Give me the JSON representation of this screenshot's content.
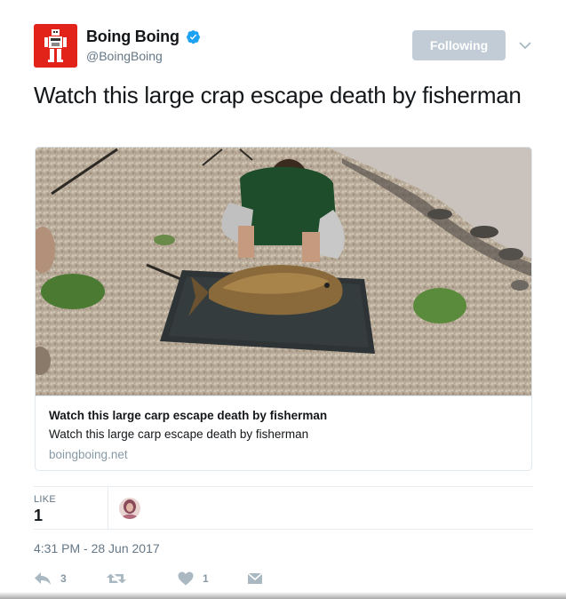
{
  "author": {
    "display_name": "Boing Boing",
    "handle": "@BoingBoing",
    "verified": true,
    "avatar_icon": "robot-icon",
    "avatar_color": "#e2231a"
  },
  "follow_button": {
    "label": "Following",
    "color": "#c2ccd6"
  },
  "menu_icon": "chevron-down-icon",
  "tweet": {
    "text": "Watch this large crap escape death by fisherman"
  },
  "card": {
    "image_icon": "video-thumbnail",
    "title": "Watch this large carp escape death by fisherman",
    "description": "Watch this large carp escape death by fisherman",
    "domain": "boingboing.net"
  },
  "stats": {
    "likes_label": "LIKE",
    "likes_value": "1"
  },
  "timestamp": "4:31 PM - 28 Jun 2017",
  "actions": {
    "reply_count": "3",
    "retweet_count": "",
    "like_count": "1",
    "accent_color": "#aab8c2"
  }
}
